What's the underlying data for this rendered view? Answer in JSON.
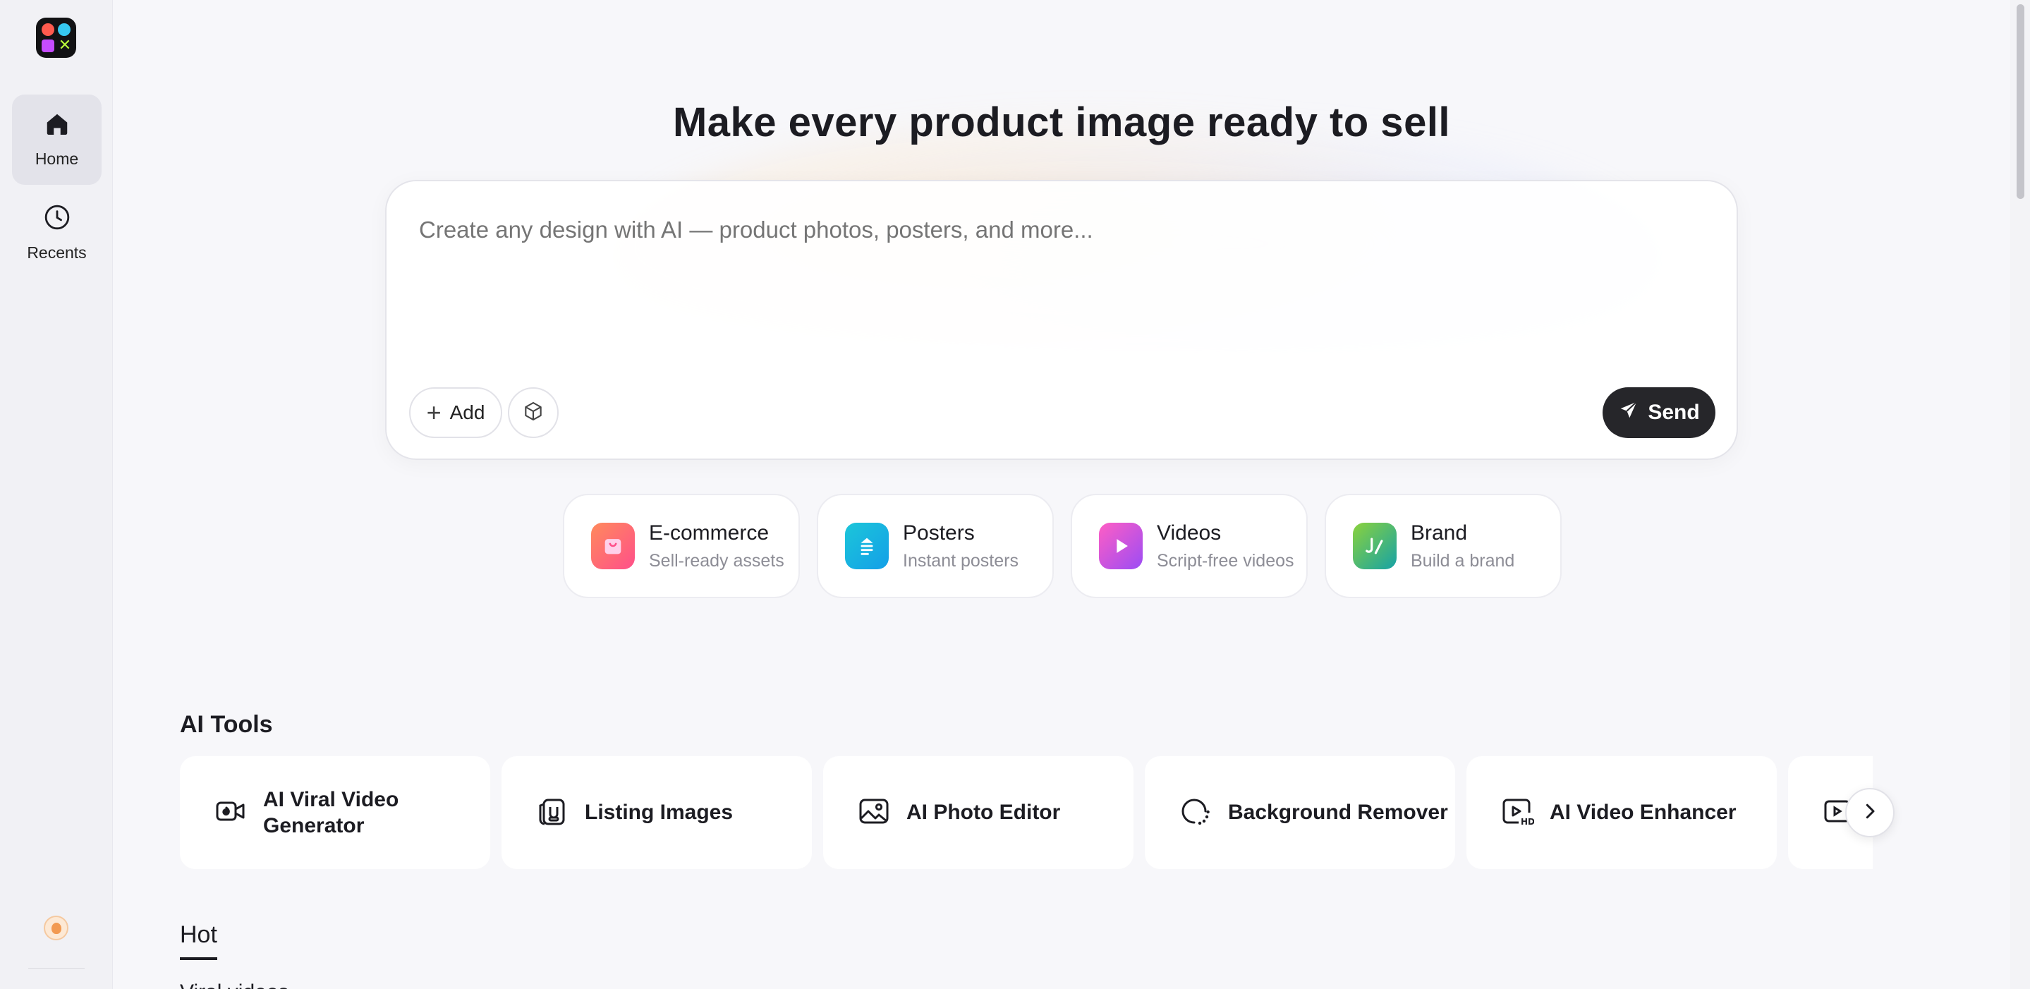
{
  "sidebar": {
    "items": [
      {
        "label": "Home",
        "icon": "home-icon",
        "active": true
      },
      {
        "label": "Recents",
        "icon": "clock-icon",
        "active": false
      }
    ]
  },
  "hero": {
    "title": "Make every product image ready to sell"
  },
  "prompt": {
    "placeholder": "Create any design with AI — product photos, posters, and more...",
    "add_label": "Add",
    "send_label": "Send"
  },
  "categories": [
    {
      "title": "E-commerce",
      "subtitle": "Sell-ready assets",
      "color": "#ff7a59"
    },
    {
      "title": "Posters",
      "subtitle": "Instant posters",
      "color": "#18b6e0"
    },
    {
      "title": "Videos",
      "subtitle": "Script-free videos",
      "color": "#b44cf5"
    },
    {
      "title": "Brand",
      "subtitle": "Build a brand",
      "color": "#43c46b"
    }
  ],
  "ai_tools": {
    "title": "AI Tools",
    "items": [
      {
        "label": "AI Viral Video Generator",
        "icon": "video-camera-icon"
      },
      {
        "label": "Listing Images",
        "icon": "listing-images-icon"
      },
      {
        "label": "AI Photo Editor",
        "icon": "photo-icon"
      },
      {
        "label": "Background Remover",
        "icon": "background-remover-icon"
      },
      {
        "label": "AI Video Enhancer",
        "icon": "hd-video-icon"
      }
    ]
  },
  "tabs": {
    "hot": "Hot",
    "cut_text": "Viral videos"
  },
  "help": {
    "label": "?"
  },
  "colors": {
    "accent_dark": "#26262a",
    "background": "#f7f7fa"
  }
}
